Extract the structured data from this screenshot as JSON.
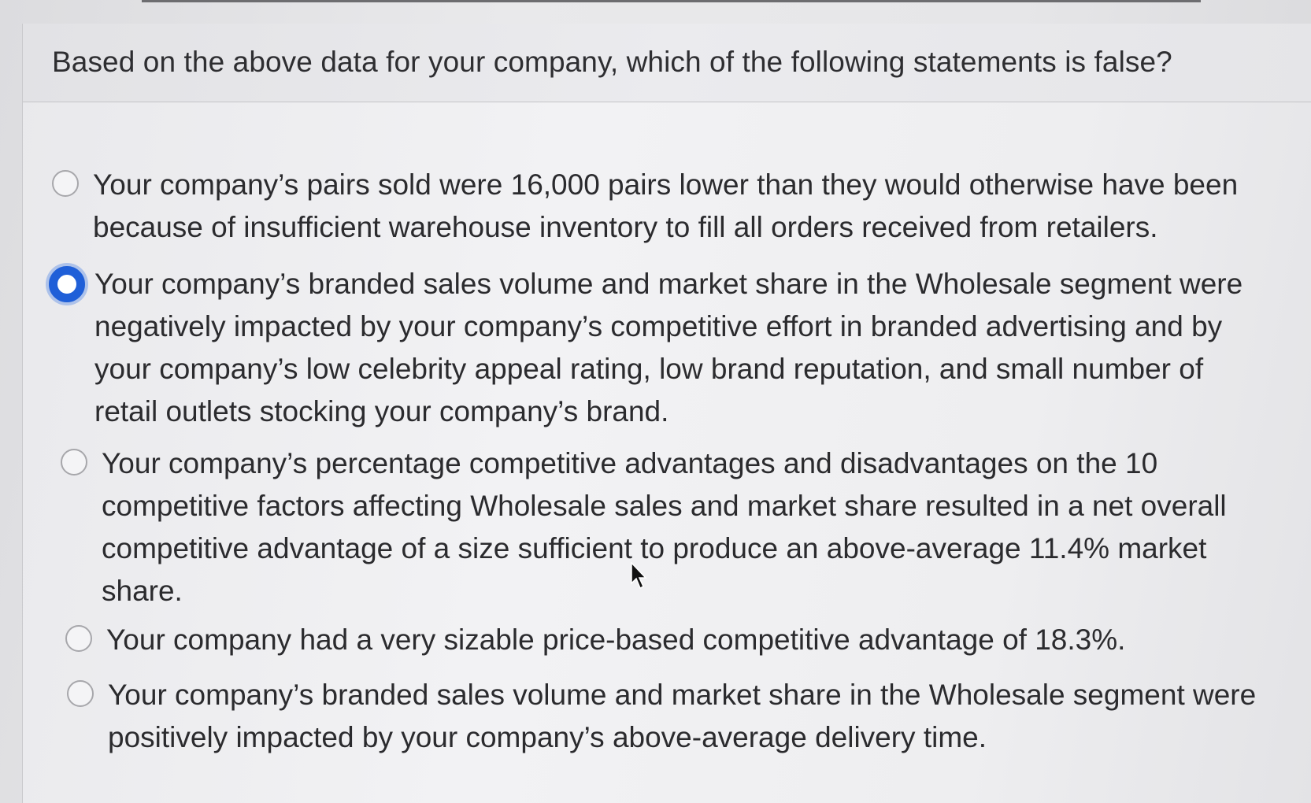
{
  "question": {
    "text": "Based on the above data for your company, which of the following statements is false?"
  },
  "options": [
    {
      "lines": [
        "Your company’s pairs sold were 16,000 pairs lower than they would otherwise have been",
        "because of insufficient warehouse inventory to fill all orders received from retailers."
      ],
      "selected": false
    },
    {
      "lines": [
        "Your company’s branded sales volume and market share in the Wholesale segment were",
        "negatively impacted by your company’s competitive effort in branded advertising and by",
        "your company’s low celebrity appeal rating, low brand reputation, and small number of",
        "retail outlets stocking your company’s brand."
      ],
      "selected": true
    },
    {
      "lines": [
        "Your company’s percentage competitive advantages and disadvantages on the 10",
        "competitive factors affecting Wholesale sales and market share resulted in a net overall",
        "competitive advantage of a size sufficient to produce an above-average 11.4% market",
        "share."
      ],
      "selected": false
    },
    {
      "lines": [
        "Your company had a very sizable price-based competitive advantage of 18.3%."
      ],
      "selected": false
    },
    {
      "lines": [
        "Your company’s branded sales volume and market share in the Wholesale segment were",
        "positively impacted by your company’s above-average delivery time."
      ],
      "selected": false
    }
  ],
  "colors": {
    "accent": "#1f5fd8",
    "text": "#2b2b2e",
    "radio_border": "#a7a7ab"
  },
  "icons": {
    "cursor": "mouse-pointer-icon"
  }
}
